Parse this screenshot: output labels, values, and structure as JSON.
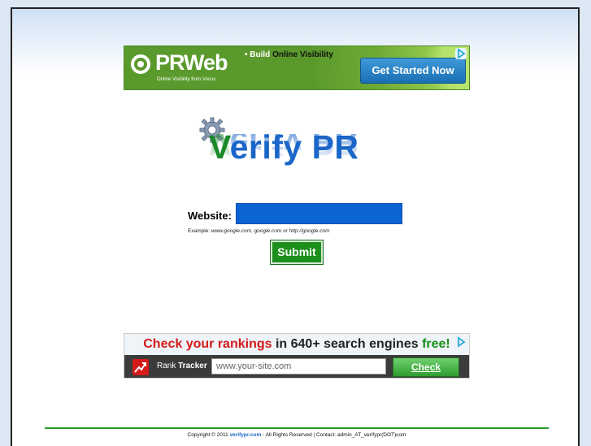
{
  "ad_top": {
    "brand": "PRWeb",
    "tagline": "Online Visibility from Vocus",
    "headline_prefix": "• Build ",
    "headline_bold": "Online Visibility",
    "cta": "Get Started Now"
  },
  "logo": {
    "verify_v": "V",
    "verify_rest": "erify PR"
  },
  "form": {
    "website_label": "Website:",
    "website_value": "",
    "example_prefix": "Example: ",
    "example_values": "www.google.com, google.com or http://google.com",
    "submit_label": "Submit"
  },
  "ad_bottom": {
    "headline_1": "Check your rankings",
    "headline_2": " in 640+ search engines ",
    "headline_3": "free!",
    "brand_1": "Rank ",
    "brand_2": "Tracker",
    "input_placeholder": "www.your-site.com",
    "check_label": "Check"
  },
  "footer": {
    "copyright_prefix": "Copyright © 2011 ",
    "site_link": "verifypr.com",
    "copyright_suffix": " - All Rights Reserved | Contact: admin_AT_verifypr(DOT)com"
  },
  "colors": {
    "brand_blue": "#1b66c8",
    "brand_green": "#1b8a2a",
    "submit_green": "#1d8f1d",
    "input_blue": "#0b63d4"
  }
}
